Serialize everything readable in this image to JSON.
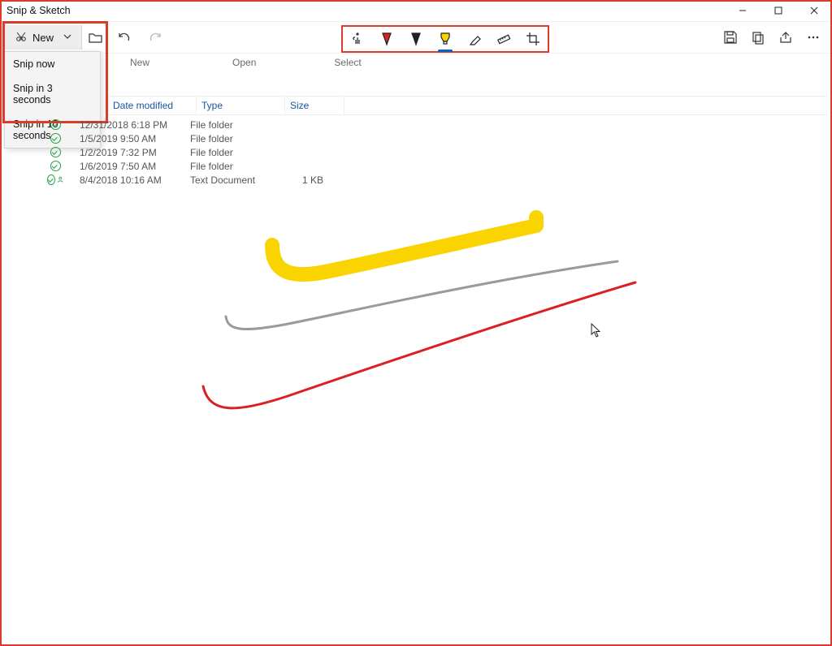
{
  "titlebar": {
    "app_name": "Snip & Sketch"
  },
  "toolbar": {
    "new_label": "New",
    "dropdown": {
      "snip_now": "Snip now",
      "snip_3": "Snip in 3 seconds",
      "snip_10": "Snip in 10 seconds"
    }
  },
  "explorer_labels": {
    "new": "New",
    "open": "Open",
    "select": "Select"
  },
  "columns": {
    "date": "Date modified",
    "type": "Type",
    "size": "Size"
  },
  "rows": [
    {
      "status": "check",
      "date": "12/31/2018 6:18 PM",
      "type": "File folder",
      "size": ""
    },
    {
      "status": "check",
      "date": "1/5/2019 9:50 AM",
      "type": "File folder",
      "size": ""
    },
    {
      "status": "check",
      "date": "1/2/2019 7:32 PM",
      "type": "File folder",
      "size": ""
    },
    {
      "status": "check",
      "date": "1/6/2019 7:50 AM",
      "type": "File folder",
      "size": ""
    },
    {
      "status": "user",
      "date": "8/4/2018 10:16 AM",
      "type": "Text Document",
      "size": "1 KB"
    }
  ],
  "colors": {
    "highlight_border": "#dc3a2a",
    "highlighter_stroke": "#f9d400",
    "pencil_stroke": "#9a9a9a",
    "pen_stroke": "#dc2020",
    "active_underline": "#0b63c4"
  }
}
